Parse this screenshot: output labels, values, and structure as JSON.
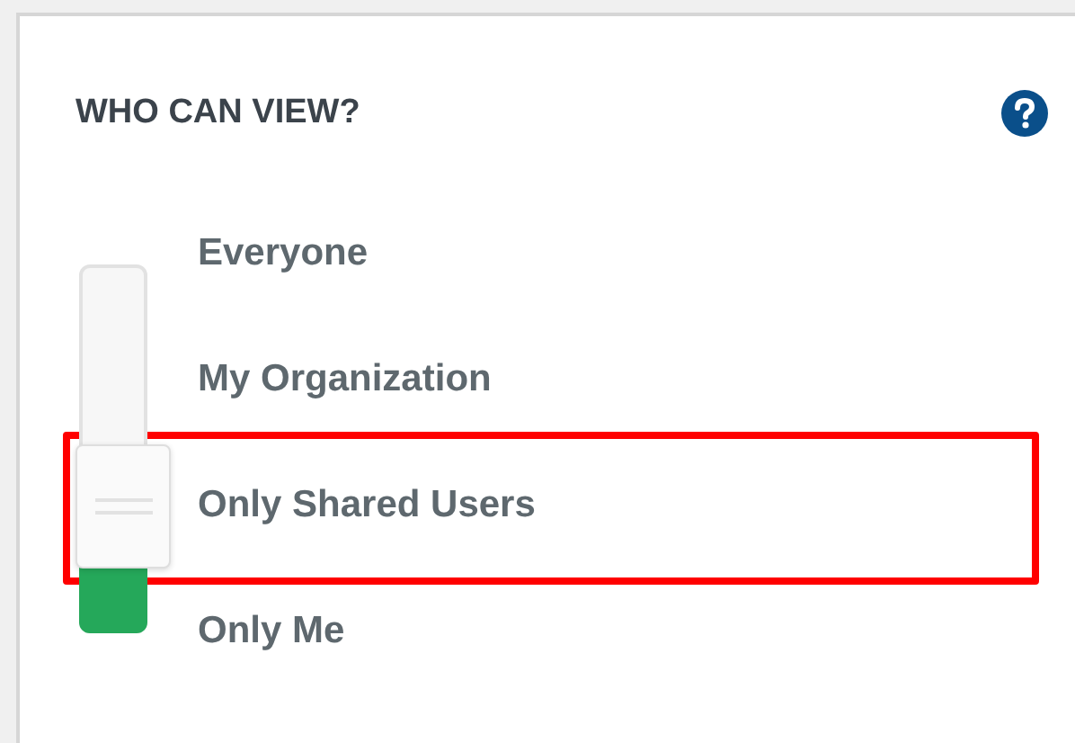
{
  "panel": {
    "title": "WHO CAN VIEW?"
  },
  "slider": {
    "level": 0.337
  },
  "options": [
    {
      "label": "Everyone",
      "selected": false
    },
    {
      "label": "My Organization",
      "selected": false
    },
    {
      "label": "Only Shared Users",
      "selected": true
    },
    {
      "label": "Only Me",
      "selected": false
    }
  ]
}
